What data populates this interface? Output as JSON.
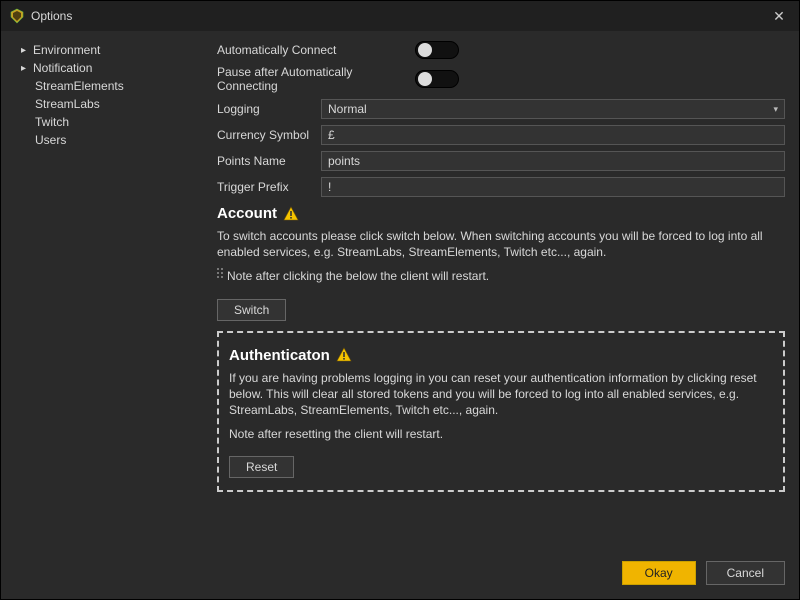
{
  "window": {
    "title": "Options"
  },
  "sidebar": {
    "items": [
      {
        "label": "Environment",
        "expandable": true
      },
      {
        "label": "Notification",
        "expandable": true
      },
      {
        "label": "StreamElements",
        "expandable": false
      },
      {
        "label": "StreamLabs",
        "expandable": false
      },
      {
        "label": "Twitch",
        "expandable": false
      },
      {
        "label": "Users",
        "expandable": false
      }
    ]
  },
  "settings": {
    "auto_connect_label": "Automatically Connect",
    "pause_after_label": "Pause after Automatically Connecting",
    "logging_label": "Logging",
    "logging_value": "Normal",
    "currency_label": "Currency Symbol",
    "currency_value": "£",
    "points_label": "Points Name",
    "points_value": "points",
    "trigger_label": "Trigger Prefix",
    "trigger_value": "!"
  },
  "account": {
    "heading": "Account",
    "body": "To switch accounts please click switch below. When switching accounts you will be forced to log into all enabled services, e.g. StreamLabs, StreamElements, Twitch etc..., again.",
    "note": "Note after clicking the below the client will restart.",
    "switch_label": "Switch"
  },
  "auth": {
    "heading": "Authenticaton",
    "body": "If you are having problems logging in you can reset your authentication information by clicking reset below. This will clear all stored tokens and you will be forced to log into all enabled services, e.g. StreamLabs, StreamElements, Twitch etc..., again.",
    "note": "Note after resetting the client will restart.",
    "reset_label": "Reset"
  },
  "footer": {
    "ok_label": "Okay",
    "cancel_label": "Cancel"
  }
}
